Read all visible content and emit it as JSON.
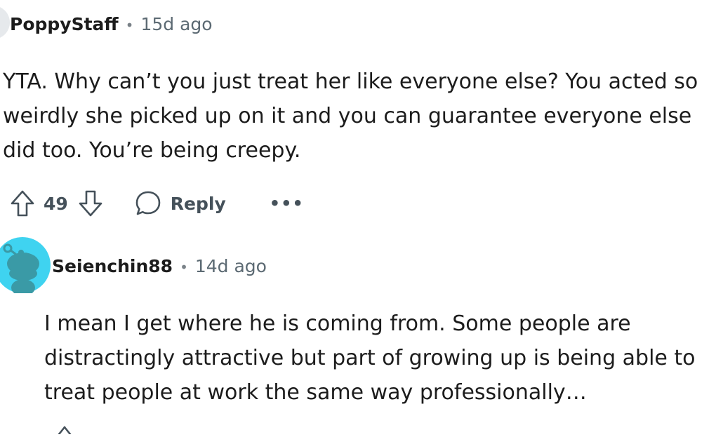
{
  "comments": [
    {
      "username": "PoppyStaff",
      "separator": "•",
      "time": "15d ago",
      "body": "YTA. Why can’t you just treat her like everyone else? You acted so weirdly she picked up on it and you can guarantee everyone else did too. You’re being creepy.",
      "score": "49",
      "reply_label": "Reply",
      "more_label": "•••"
    },
    {
      "username": "Seienchin88",
      "separator": "•",
      "time": "14d ago",
      "body": "I mean I get where he is coming from. Some people are distractingly attractive but part of growing up is being able to treat people at work the same way professionally…"
    }
  ],
  "colors": {
    "text": "#1c1c1c",
    "meta": "#5c6a73",
    "action": "#45515a",
    "snoo_bg": "#3fd3f0",
    "snoo_body": "#3a9aa6"
  }
}
